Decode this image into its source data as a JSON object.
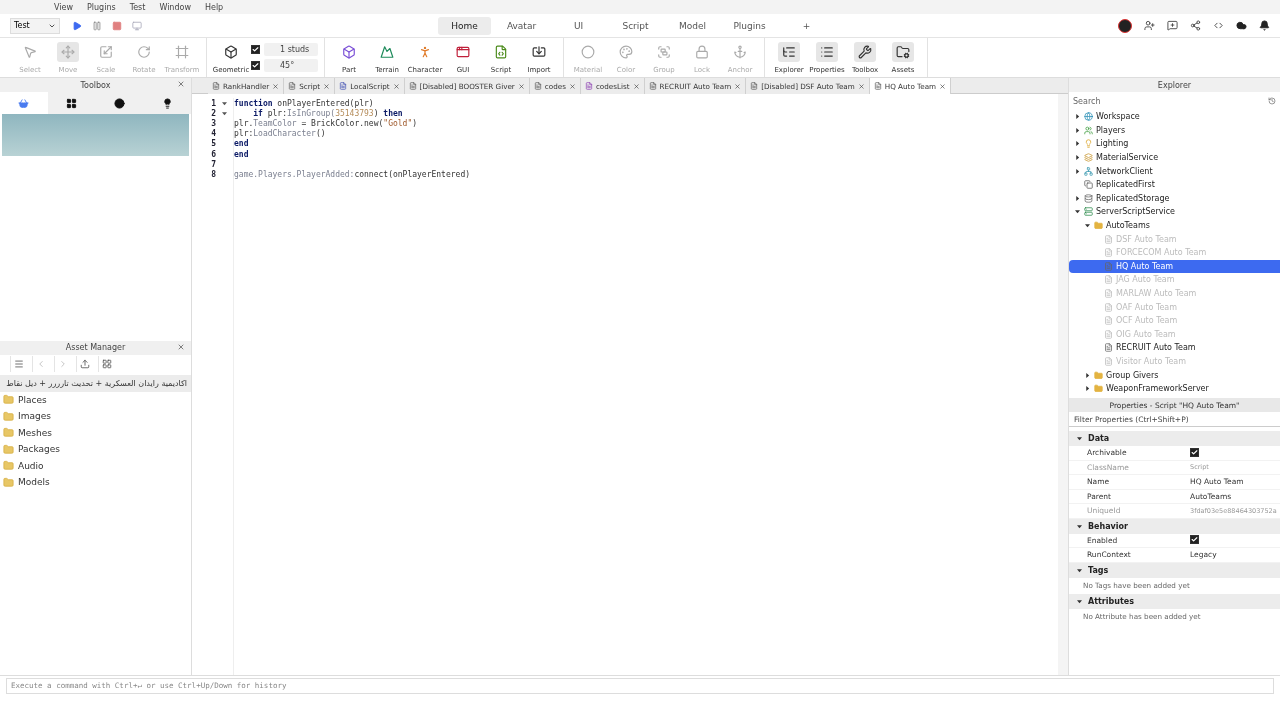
{
  "menu": [
    "View",
    "Plugins",
    "Test",
    "Window",
    "Help"
  ],
  "run_controls": {
    "mode": "Test"
  },
  "ribbon_tabs": [
    {
      "label": "Home",
      "selected": true
    },
    {
      "label": "Avatar",
      "selected": false
    },
    {
      "label": "UI",
      "selected": false
    },
    {
      "label": "Script",
      "selected": false
    },
    {
      "label": "Model",
      "selected": false
    },
    {
      "label": "Plugins",
      "selected": false
    },
    {
      "label": "+",
      "selected": false
    }
  ],
  "tool_groups": [
    [
      {
        "label": "Select",
        "kind": "select",
        "disabled": true,
        "selected": false
      },
      {
        "label": "Move",
        "kind": "move",
        "disabled": true,
        "selected": true
      },
      {
        "label": "Scale",
        "kind": "scale",
        "disabled": true,
        "selected": false
      },
      {
        "label": "Rotate",
        "kind": "rotate",
        "disabled": true,
        "selected": false
      },
      {
        "label": "Transform",
        "kind": "transform",
        "disabled": true,
        "selected": false
      }
    ],
    [
      {
        "label": "Geometric",
        "kind": "geometric",
        "disabled": false,
        "selected": false
      }
    ],
    [
      {
        "label": "Part",
        "kind": "part",
        "disabled": false,
        "selected": false
      },
      {
        "label": "Terrain",
        "kind": "terrain",
        "disabled": false,
        "selected": false
      },
      {
        "label": "Character",
        "kind": "character",
        "disabled": false,
        "selected": false
      },
      {
        "label": "GUI",
        "kind": "gui",
        "disabled": false,
        "selected": false
      },
      {
        "label": "Script",
        "kind": "script",
        "disabled": false,
        "selected": false
      },
      {
        "label": "Import",
        "kind": "import",
        "disabled": false,
        "selected": false
      }
    ],
    [
      {
        "label": "Material",
        "kind": "material",
        "disabled": true,
        "selected": false
      },
      {
        "label": "Color",
        "kind": "color",
        "disabled": true,
        "selected": false
      },
      {
        "label": "Group",
        "kind": "group",
        "disabled": true,
        "selected": false
      },
      {
        "label": "Lock",
        "kind": "lock",
        "disabled": true,
        "selected": false
      },
      {
        "label": "Anchor",
        "kind": "anchor",
        "disabled": true,
        "selected": false
      }
    ],
    [
      {
        "label": "Explorer",
        "kind": "explorer",
        "disabled": false,
        "selected": true
      },
      {
        "label": "Properties",
        "kind": "properties",
        "disabled": false,
        "selected": true
      },
      {
        "label": "Toolbox",
        "kind": "toolbox",
        "disabled": false,
        "selected": true
      },
      {
        "label": "Assets",
        "kind": "assets",
        "disabled": false,
        "selected": true
      }
    ]
  ],
  "snap": [
    {
      "checked": true,
      "value": "1 studs"
    },
    {
      "checked": true,
      "value": "45°"
    }
  ],
  "toolbox": {
    "title": "Toolbox",
    "tabs": [
      {
        "kind": "marketplace",
        "selected": true
      },
      {
        "kind": "inventory",
        "selected": false
      },
      {
        "kind": "recent",
        "selected": false
      },
      {
        "kind": "creations",
        "selected": false
      }
    ]
  },
  "asset_manager": {
    "title": "Asset Manager",
    "breadcrumb": "اكاديمية رايدان العسكرية + تحديث تارررر + ديل نقاط",
    "folders": [
      "Places",
      "Images",
      "Meshes",
      "Packages",
      "Audio",
      "Models"
    ]
  },
  "editor": {
    "tabs": [
      {
        "label": "RankHandler",
        "kind": "script",
        "selected": false
      },
      {
        "label": "Script",
        "kind": "script",
        "selected": false
      },
      {
        "label": "LocalScript",
        "kind": "local",
        "selected": false
      },
      {
        "label": "[Disabled] BOOSTER Giver",
        "kind": "script",
        "selected": false
      },
      {
        "label": "codes",
        "kind": "script",
        "selected": false
      },
      {
        "label": "codesList",
        "kind": "module",
        "selected": false
      },
      {
        "label": "RECRUIT Auto Team",
        "kind": "script",
        "selected": false
      },
      {
        "label": "[Disabled] DSF Auto Team",
        "kind": "script",
        "selected": false
      },
      {
        "label": "HQ Auto Team",
        "kind": "script",
        "selected": true
      }
    ],
    "lines": [
      {
        "number": "1",
        "fold": true,
        "tokens": [
          {
            "text": "function",
            "kind": "keyword"
          },
          {
            "text": " onPlayerEntered(plr)",
            "kind": "plain"
          }
        ]
      },
      {
        "number": "2",
        "fold": true,
        "tokens": [
          {
            "text": "    if ",
            "kind": "keyword"
          },
          {
            "text": "plr:",
            "kind": "plain"
          },
          {
            "text": "IsInGroup(",
            "kind": "method"
          },
          {
            "text": "35143793",
            "kind": "number"
          },
          {
            "text": ") ",
            "kind": "plain"
          },
          {
            "text": "then",
            "kind": "keyword"
          }
        ]
      },
      {
        "number": "3",
        "fold": false,
        "tokens": [
          {
            "text": "plr.",
            "kind": "plain"
          },
          {
            "text": "TeamColor",
            "kind": "method"
          },
          {
            "text": " = BrickColor.new(",
            "kind": "plain"
          },
          {
            "text": "\"Gold\"",
            "kind": "string"
          },
          {
            "text": ")",
            "kind": "plain"
          }
        ]
      },
      {
        "number": "4",
        "fold": false,
        "tokens": [
          {
            "text": "plr:",
            "kind": "plain"
          },
          {
            "text": "LoadCharacter",
            "kind": "method"
          },
          {
            "text": "()",
            "kind": "plain"
          }
        ]
      },
      {
        "number": "5",
        "fold": false,
        "tokens": [
          {
            "text": "end",
            "kind": "keyword"
          }
        ]
      },
      {
        "number": "6",
        "fold": false,
        "tokens": [
          {
            "text": "end",
            "kind": "keyword"
          }
        ]
      },
      {
        "number": "7",
        "fold": false
      },
      {
        "number": "8",
        "fold": false,
        "tokens": [
          {
            "text": "game.Players.PlayerAdded:",
            "kind": "method"
          },
          {
            "text": "connect(onPlayerEntered)",
            "kind": "plain"
          }
        ]
      }
    ]
  },
  "explorer": {
    "title": "Explorer",
    "search_placeholder": "Search",
    "tree": [
      {
        "name": "Workspace",
        "kind": "workspace",
        "expanded": false,
        "disabled": false,
        "selected": false
      },
      {
        "name": "Players",
        "kind": "players",
        "expanded": false,
        "disabled": false,
        "selected": false
      },
      {
        "name": "Lighting",
        "kind": "lighting",
        "expanded": false,
        "disabled": false,
        "selected": false
      },
      {
        "name": "MaterialService",
        "kind": "service",
        "expanded": false,
        "disabled": false,
        "selected": false
      },
      {
        "name": "NetworkClient",
        "kind": "network",
        "expanded": false,
        "disabled": false,
        "selected": false
      },
      {
        "name": "ReplicatedFirst",
        "kind": "first",
        "disabled": false,
        "selected": false
      },
      {
        "name": "ReplicatedStorage",
        "kind": "storage",
        "expanded": false,
        "disabled": false,
        "selected": false
      },
      {
        "name": "ServerScriptService",
        "kind": "server",
        "expanded": true,
        "disabled": false,
        "selected": false,
        "children": [
          {
            "name": "AutoTeams",
            "kind": "folder",
            "expanded": true,
            "disabled": false,
            "selected": false,
            "children": [
              {
                "name": "DSF Auto Team",
                "kind": "script",
                "disabled": true,
                "selected": false
              },
              {
                "name": "FORCECOM Auto Team",
                "kind": "script",
                "disabled": true,
                "selected": false
              },
              {
                "name": "HQ Auto Team",
                "kind": "script",
                "disabled": false,
                "selected": true
              },
              {
                "name": "JAG Auto Team",
                "kind": "script",
                "disabled": true,
                "selected": false
              },
              {
                "name": "MARLAW Auto Team",
                "kind": "script",
                "disabled": true,
                "selected": false
              },
              {
                "name": "OAF Auto Team",
                "kind": "script",
                "disabled": true,
                "selected": false
              },
              {
                "name": "OCF Auto Team",
                "kind": "script",
                "disabled": true,
                "selected": false
              },
              {
                "name": "OIG Auto Team",
                "kind": "script",
                "disabled": true,
                "selected": false
              },
              {
                "name": "RECRUIT Auto Team",
                "kind": "script",
                "disabled": false,
                "selected": false
              },
              {
                "name": "Visitor Auto Team",
                "kind": "script",
                "disabled": true,
                "selected": false
              }
            ]
          },
          {
            "name": "Group Givers",
            "kind": "folder",
            "expanded": false,
            "disabled": false,
            "selected": false
          },
          {
            "name": "WeaponFrameworkServer",
            "kind": "folder",
            "expanded": false,
            "disabled": false,
            "selected": false
          }
        ]
      }
    ]
  },
  "properties": {
    "title": "Properties - Script \"HQ Auto Team\"",
    "filter_placeholder": "Filter Properties (Ctrl+Shift+P)",
    "sections": [
      {
        "name": "Data",
        "expanded": true,
        "rows": [
          {
            "name": "Archivable",
            "kind": "check",
            "checked": true,
            "readonly": false
          },
          {
            "name": "ClassName",
            "kind": "text",
            "value": "Script",
            "readonly": true
          },
          {
            "name": "Name",
            "kind": "text",
            "value": "HQ Auto Team",
            "readonly": false
          },
          {
            "name": "Parent",
            "kind": "text",
            "value": "AutoTeams",
            "readonly": false
          },
          {
            "name": "UniqueId",
            "kind": "text",
            "value": "3fdaf03e5e88464303752a",
            "readonly": true
          }
        ]
      },
      {
        "name": "Behavior",
        "expanded": true,
        "rows": [
          {
            "name": "Enabled",
            "kind": "check",
            "checked": true,
            "readonly": false
          },
          {
            "name": "RunContext",
            "kind": "text",
            "value": "Legacy",
            "readonly": false
          }
        ]
      },
      {
        "name": "Tags",
        "expanded": true,
        "empty": "No Tags have been added yet"
      },
      {
        "name": "Attributes",
        "expanded": true,
        "empty": "No Attribute has been added yet"
      }
    ]
  },
  "command_bar": {
    "placeholder": "Execute a command with Ctrl+↵ or use Ctrl+Up/Down for history"
  }
}
